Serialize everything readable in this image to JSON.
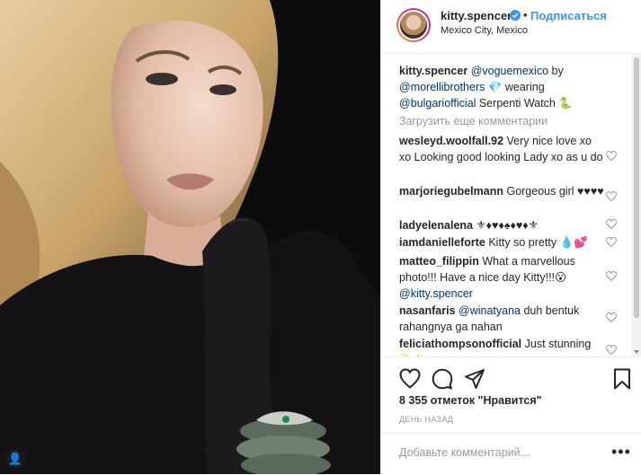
{
  "post": {
    "username": "kitty.spencer",
    "separator": "•",
    "follow_label": "Подписаться",
    "location": "Mexico City, Mexico"
  },
  "caption": {
    "username": "kitty.spencer",
    "mention1": "@voguemexico",
    "text1": " by ",
    "mention2": "@morellibrothers",
    "text2": " 💎 wearing ",
    "mention3": "@bulgariofficial",
    "text3": " Serpenti Watch 🐍"
  },
  "load_more": "Загрузить еще комментарии",
  "comments": [
    {
      "username": "wesleyd.woolfall.92",
      "text": " Very nice love xo xo Looking good looking Lady xo as u do"
    },
    {
      "username": "marjoriegubelmann",
      "text": " Gorgeous girl ♥♥♥♥"
    },
    {
      "username": "ladyelenalena",
      "text": " ⚜♦♥♦♠♦♥♦⚜"
    },
    {
      "username": "iamdanielleforte",
      "text": " Kitty so pretty 💧💕"
    },
    {
      "username": "matteo_filippin",
      "text": " What a marvellous photo!!! Have a nice day Kitty!!!😮",
      "mention": "@kitty.spencer"
    },
    {
      "username": "nasanfaris",
      "mention": "@winatyana",
      "text": " duh bentuk rahangnya ga nahan"
    },
    {
      "username": "feliciathompsonofficial",
      "text": " Just stunning 💫✨"
    }
  ],
  "likes": "8 355 отметок \"Нравится\"",
  "time_ago": "ДЕНЬ НАЗАД",
  "add_comment_placeholder": "Добавьте комментарий...",
  "more_options": "•••",
  "icons": {
    "heart": "heart-icon",
    "comment": "comment-icon",
    "share": "share-icon",
    "bookmark": "bookmark-icon",
    "verified": "verified-badge-icon",
    "tag": "person-tag-icon"
  },
  "colors": {
    "link_blue": "#3897f0",
    "mention": "#003569",
    "muted": "#999999",
    "text": "#262626",
    "photo_bg": "#0c0b0d"
  }
}
